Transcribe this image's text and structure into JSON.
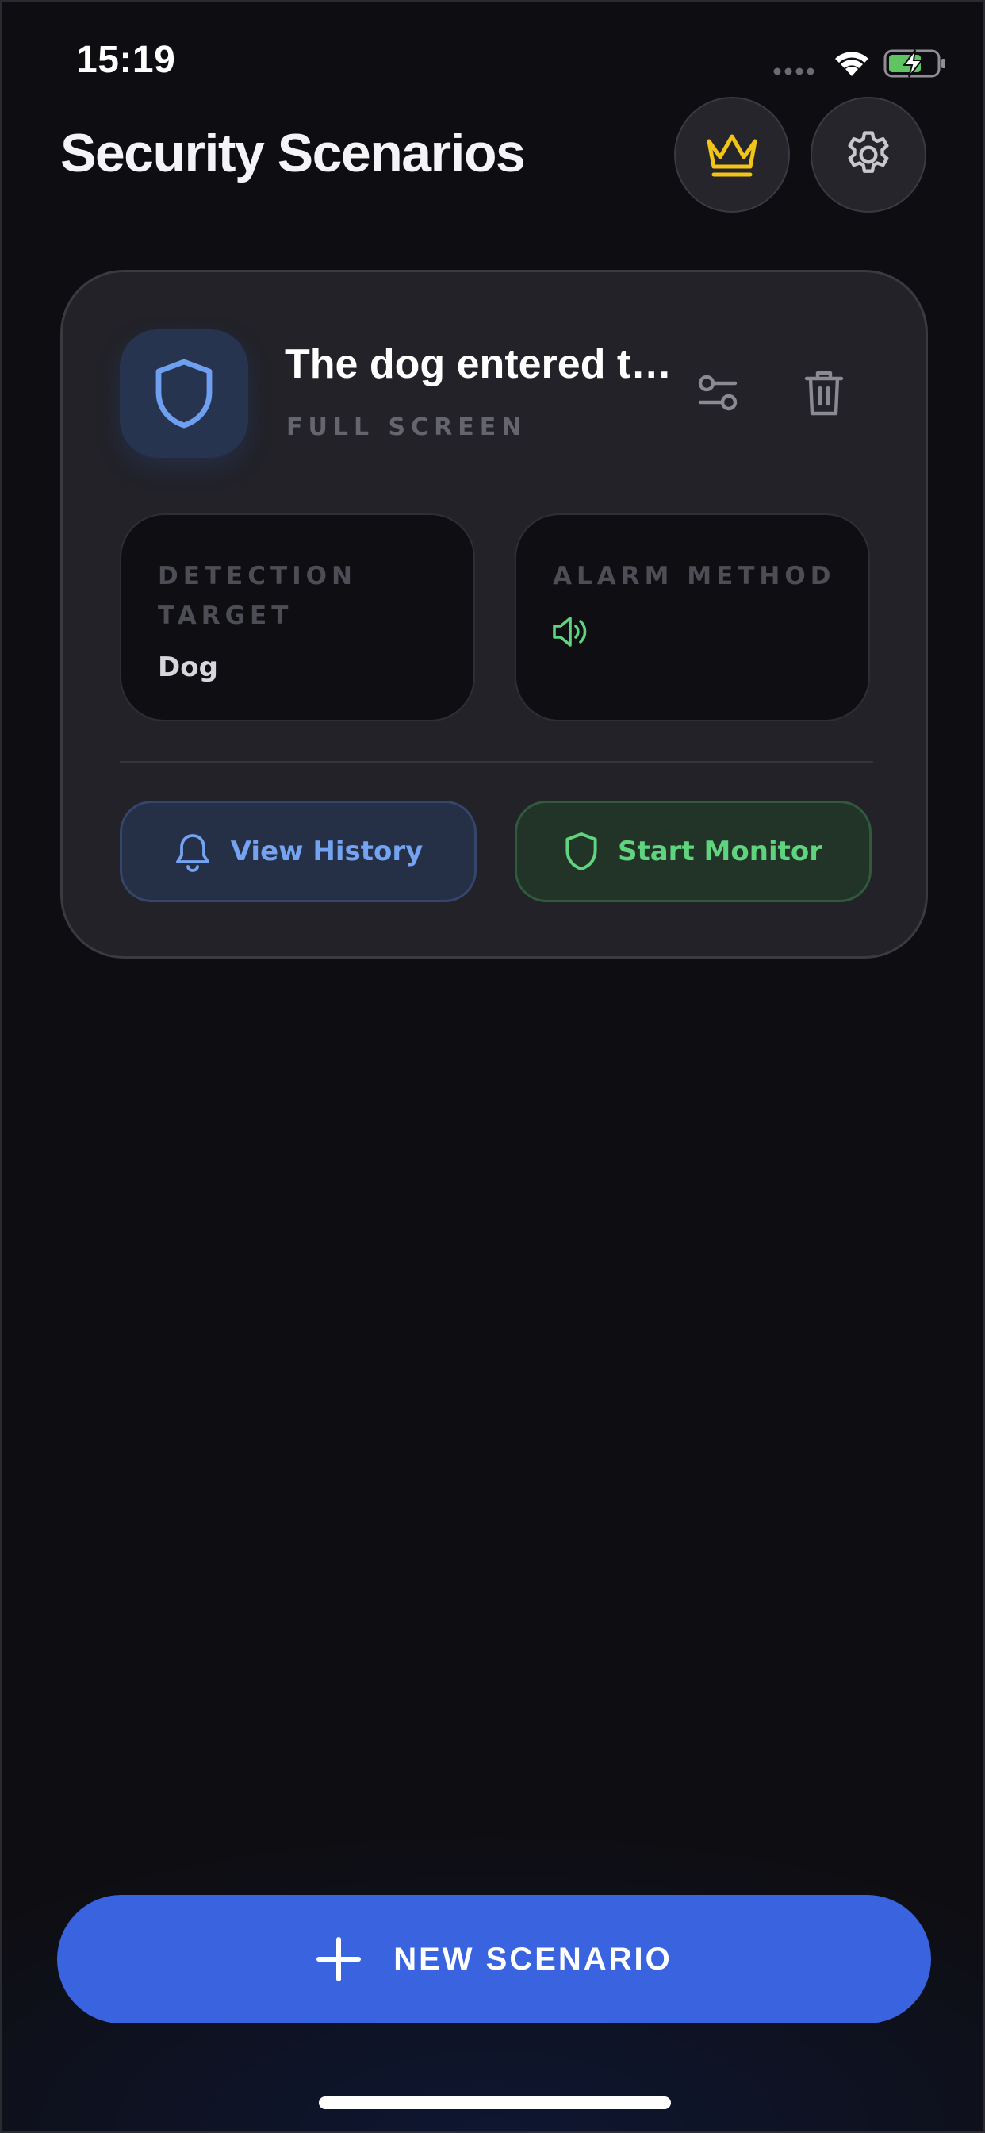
{
  "status_bar": {
    "time": "15:19",
    "icons": [
      "signal-dots-icon",
      "wifi-icon",
      "battery-charging-icon"
    ]
  },
  "header": {
    "title": "Security Scenarios",
    "premium_icon": "crown-icon",
    "settings_icon": "gear-icon"
  },
  "scenario": {
    "icon": "shield-icon",
    "title": "The dog entered the room",
    "subtitle": "FULL SCREEN",
    "detection_label": "DETECTION TARGET",
    "detection_value": "Dog",
    "alarm_label": "ALARM METHOD",
    "alarm_icon": "speaker-icon",
    "history_label": "View History",
    "monitor_label": "Start Monitor"
  },
  "cta": {
    "label": "NEW SCENARIO"
  },
  "colors": {
    "accent_blue": "#3a63e0",
    "history_text": "#74a3f2",
    "monitor_green": "#5fd37e",
    "crown_yellow": "#f2c418"
  }
}
